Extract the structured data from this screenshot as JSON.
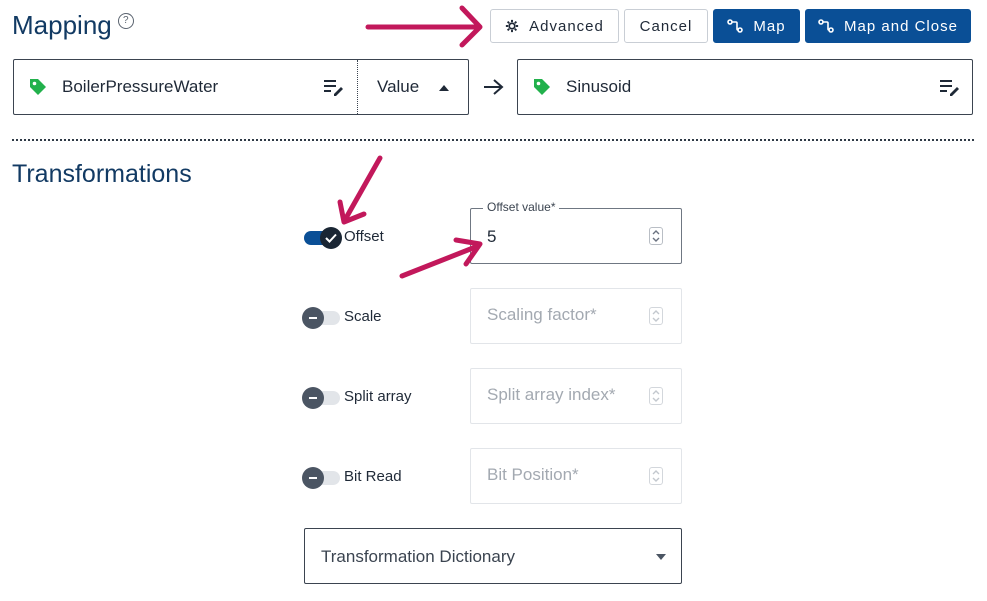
{
  "header": {
    "title": "Mapping",
    "help": "?",
    "buttons": {
      "advanced": "Advanced",
      "cancel": "Cancel",
      "map": "Map",
      "map_close": "Map and Close"
    }
  },
  "source": {
    "tag": "BoilerPressureWater",
    "property": "Value"
  },
  "target": {
    "tag": "Sinusoid"
  },
  "section": {
    "title": "Transformations"
  },
  "transformations": {
    "offset": {
      "label": "Offset",
      "enabled": true,
      "field_label": "Offset value*",
      "value": "5"
    },
    "scale": {
      "label": "Scale",
      "enabled": false,
      "placeholder": "Scaling factor*"
    },
    "split_array": {
      "label": "Split array",
      "enabled": false,
      "placeholder": "Split array index*"
    },
    "bit_read": {
      "label": "Bit Read",
      "enabled": false,
      "placeholder": "Bit Position*"
    }
  },
  "dictionary": {
    "label": "Transformation Dictionary"
  },
  "colors": {
    "primary": "#0a4f96",
    "heading": "#123a63",
    "tag": "#22b14c",
    "annotation": "#c2185b"
  }
}
